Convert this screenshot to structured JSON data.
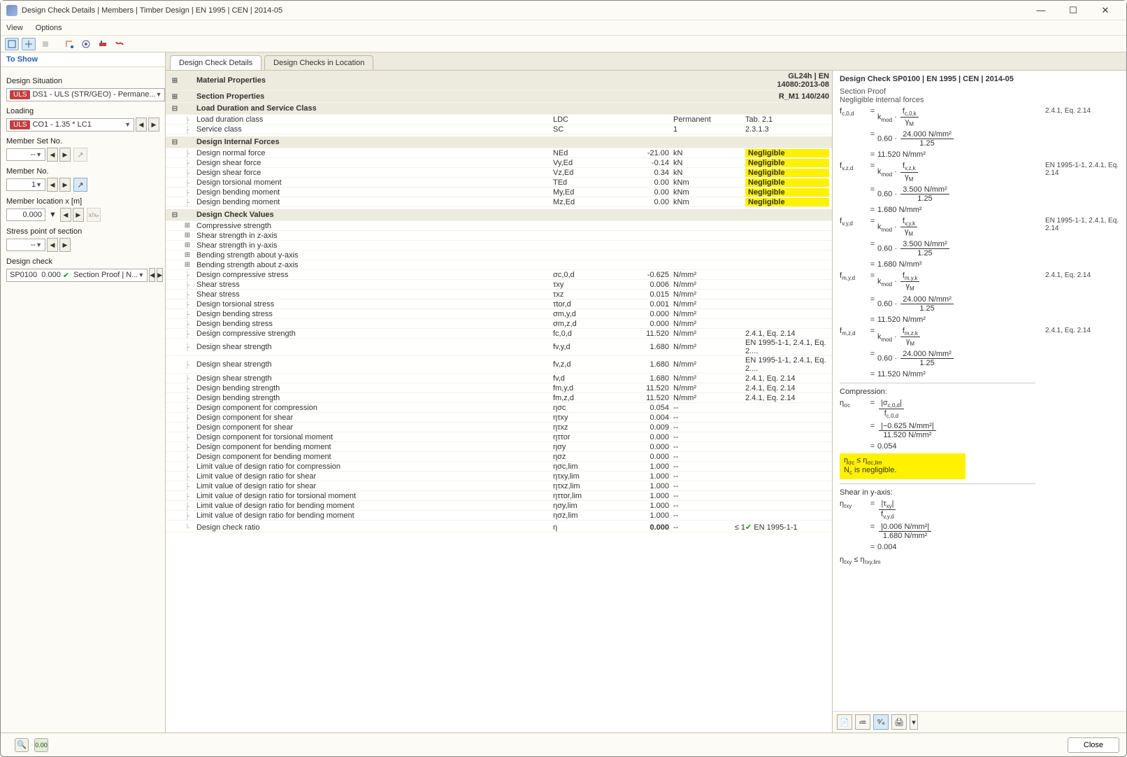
{
  "window": {
    "title": "Design Check Details | Members | Timber Design | EN 1995 | CEN | 2014-05"
  },
  "menu": {
    "view": "View",
    "options": "Options"
  },
  "sidebar": {
    "toshow": "To Show",
    "designSituation_lbl": "Design Situation",
    "designSituation_pill": "ULS",
    "designSituation_val": "DS1 - ULS (STR/GEO) - Permane...",
    "loading_lbl": "Loading",
    "loading_pill": "ULS",
    "loading_val": "CO1 - 1.35 * LC1",
    "memberSet_lbl": "Member Set No.",
    "memberSet_val": "--",
    "memberNo_lbl": "Member No.",
    "memberNo_val": "1",
    "memberLoc_lbl": "Member location x [m]",
    "memberLoc_val": "0.000",
    "stressPoint_lbl": "Stress point of section",
    "stressPoint_val": "--",
    "designCheck_lbl": "Design check",
    "designCheck_code": "SP0100",
    "designCheck_ratio": "0.000",
    "designCheck_text": "Section Proof | N..."
  },
  "tabs": {
    "t1": "Design Check Details",
    "t2": "Design Checks in Location"
  },
  "sections": {
    "matprop": "Material Properties",
    "matprop_ref": "GL24h | EN 14080:2013-08",
    "secprop": "Section Properties",
    "secprop_ref": "R_M1 140/240",
    "loadservice": "Load Duration and Service Class",
    "internalforces": "Design Internal Forces",
    "checkvalues": "Design Check Values",
    "compstr": "Compressive strength",
    "shearZ": "Shear strength in z-axis",
    "shearY": "Shear strength in y-axis",
    "bendY": "Bending strength about y-axis",
    "bendZ": "Bending strength about z-axis"
  },
  "rows_loadservice": [
    {
      "label": "Load duration class",
      "sym": "LDC",
      "val": "",
      "un": "Permanent",
      "ref": "Tab. 2.1"
    },
    {
      "label": "Service class",
      "sym": "SC",
      "val": "",
      "un": "1",
      "ref": "2.3.1.3"
    }
  ],
  "rows_internal": [
    {
      "label": "Design normal force",
      "sym": "NEd",
      "val": "-21.00",
      "un": "kN",
      "ref": "Negligible"
    },
    {
      "label": "Design shear force",
      "sym": "Vy,Ed",
      "val": "-0.14",
      "un": "kN",
      "ref": "Negligible"
    },
    {
      "label": "Design shear force",
      "sym": "Vz,Ed",
      "val": "0.34",
      "un": "kN",
      "ref": "Negligible"
    },
    {
      "label": "Design torsional moment",
      "sym": "TEd",
      "val": "0.00",
      "un": "kNm",
      "ref": "Negligible"
    },
    {
      "label": "Design bending moment",
      "sym": "My,Ed",
      "val": "0.00",
      "un": "kNm",
      "ref": "Negligible"
    },
    {
      "label": "Design bending moment",
      "sym": "Mz,Ed",
      "val": "0.00",
      "un": "kNm",
      "ref": "Negligible"
    }
  ],
  "rows_values": [
    {
      "label": "Design compressive stress",
      "sym": "σc,0,d",
      "val": "-0.625",
      "un": "N/mm²",
      "ref": ""
    },
    {
      "label": "Shear stress",
      "sym": "τxy",
      "val": "0.006",
      "un": "N/mm²",
      "ref": ""
    },
    {
      "label": "Shear stress",
      "sym": "τxz",
      "val": "0.015",
      "un": "N/mm²",
      "ref": ""
    },
    {
      "label": "Design torsional stress",
      "sym": "τtor,d",
      "val": "0.001",
      "un": "N/mm²",
      "ref": ""
    },
    {
      "label": "Design bending stress",
      "sym": "σm,y,d",
      "val": "0.000",
      "un": "N/mm²",
      "ref": ""
    },
    {
      "label": "Design bending stress",
      "sym": "σm,z,d",
      "val": "0.000",
      "un": "N/mm²",
      "ref": ""
    },
    {
      "label": "Design compressive strength",
      "sym": "fc,0,d",
      "val": "11.520",
      "un": "N/mm²",
      "ref": "2.4.1, Eq. 2.14"
    },
    {
      "label": "Design shear strength",
      "sym": "fv,y,d",
      "val": "1.680",
      "un": "N/mm²",
      "ref": "EN 1995-1-1, 2.4.1, Eq. 2...."
    },
    {
      "label": "Design shear strength",
      "sym": "fv,z,d",
      "val": "1.680",
      "un": "N/mm²",
      "ref": "EN 1995-1-1, 2.4.1, Eq. 2...."
    },
    {
      "label": "Design shear strength",
      "sym": "fv,d",
      "val": "1.680",
      "un": "N/mm²",
      "ref": "2.4.1, Eq. 2.14"
    },
    {
      "label": "Design bending strength",
      "sym": "fm,y,d",
      "val": "11.520",
      "un": "N/mm²",
      "ref": "2.4.1, Eq. 2.14"
    },
    {
      "label": "Design bending strength",
      "sym": "fm,z,d",
      "val": "11.520",
      "un": "N/mm²",
      "ref": "2.4.1, Eq. 2.14"
    },
    {
      "label": "Design component for compression",
      "sym": "ησc",
      "val": "0.054",
      "un": "--",
      "ref": ""
    },
    {
      "label": "Design component for shear",
      "sym": "ητxy",
      "val": "0.004",
      "un": "--",
      "ref": ""
    },
    {
      "label": "Design component for shear",
      "sym": "ητxz",
      "val": "0.009",
      "un": "--",
      "ref": ""
    },
    {
      "label": "Design component for torsional moment",
      "sym": "ηττor",
      "val": "0.000",
      "un": "--",
      "ref": ""
    },
    {
      "label": "Design component for bending moment",
      "sym": "ησy",
      "val": "0.000",
      "un": "--",
      "ref": ""
    },
    {
      "label": "Design component for bending moment",
      "sym": "ησz",
      "val": "0.000",
      "un": "--",
      "ref": ""
    },
    {
      "label": "Limit value of design ratio for compression",
      "sym": "ησc,lim",
      "val": "1.000",
      "un": "--",
      "ref": ""
    },
    {
      "label": "Limit value of design ratio for shear",
      "sym": "ητxy,lim",
      "val": "1.000",
      "un": "--",
      "ref": ""
    },
    {
      "label": "Limit value of design ratio for shear",
      "sym": "ητxz,lim",
      "val": "1.000",
      "un": "--",
      "ref": ""
    },
    {
      "label": "Limit value of design ratio for torsional moment",
      "sym": "ηττor,lim",
      "val": "1.000",
      "un": "--",
      "ref": ""
    },
    {
      "label": "Limit value of design ratio for bending moment",
      "sym": "ησy,lim",
      "val": "1.000",
      "un": "--",
      "ref": ""
    },
    {
      "label": "Limit value of design ratio for bending moment",
      "sym": "ησz,lim",
      "val": "1.000",
      "un": "--",
      "ref": ""
    }
  ],
  "finalrow": {
    "label": "Design check ratio",
    "sym": "η",
    "val": "0.000",
    "un": "--",
    "lim": "≤ 1",
    "ref": "EN 1995-1-1"
  },
  "right": {
    "title": "Design Check SP0100 | EN 1995 | CEN | 2014-05",
    "sub1": "Section Proof",
    "sub2": "Negligible internal forces",
    "ref_2414": "2.4.1, Eq. 2.14",
    "ref_en": "EN 1995-1-1, 2.4.1, Eq. 2.14",
    "eqs": [
      {
        "lhs": "f<sub class='ssub'>c,0,d</sub>",
        "kmod": "k<sub class='ssub'>mod</sub>",
        "fnum": "f<sub class='ssub'>c,0,k</sub>",
        "fden": "γ<sub class='ssub'>M</sub>",
        "vnum": "24.000 N/mm²",
        "vden": "1.25",
        "res": "11.520 N/mm²",
        "ref": "2.4.1, Eq. 2.14"
      },
      {
        "lhs": "f<sub class='ssub'>v,z,d</sub>",
        "kmod": "k<sub class='ssub'>mod</sub>",
        "fnum": "f<sub class='ssub'>v,z,k</sub>",
        "fden": "γ<sub class='ssub'>M</sub>",
        "vnum": "3.500 N/mm²",
        "vden": "1.25",
        "res": "1.680 N/mm²",
        "ref": "EN 1995-1-1, 2.4.1, Eq. 2.14"
      },
      {
        "lhs": "f<sub class='ssub'>v,y,d</sub>",
        "kmod": "k<sub class='ssub'>mod</sub>",
        "fnum": "f<sub class='ssub'>v,y,k</sub>",
        "fden": "γ<sub class='ssub'>M</sub>",
        "vnum": "3.500 N/mm²",
        "vden": "1.25",
        "res": "1.680 N/mm²",
        "ref": "EN 1995-1-1, 2.4.1, Eq. 2.14"
      },
      {
        "lhs": "f<sub class='ssub'>m,y,d</sub>",
        "kmod": "k<sub class='ssub'>mod</sub>",
        "fnum": "f<sub class='ssub'>m,y,k</sub>",
        "fden": "γ<sub class='ssub'>M</sub>",
        "vnum": "24.000 N/mm²",
        "vden": "1.25",
        "res": "11.520 N/mm²",
        "ref": "2.4.1, Eq. 2.14"
      },
      {
        "lhs": "f<sub class='ssub'>m,z,d</sub>",
        "kmod": "k<sub class='ssub'>mod</sub>",
        "fnum": "f<sub class='ssub'>m,z,k</sub>",
        "fden": "γ<sub class='ssub'>M</sub>",
        "vnum": "24.000 N/mm²",
        "vden": "1.25",
        "res": "11.520 N/mm²",
        "ref": "2.4.1, Eq. 2.14"
      }
    ],
    "compression_lbl": "Compression:",
    "compression_eta_num": "|σ<sub class='ssub'>c,0,d</sub>|",
    "compression_eta_den": "f<sub class='ssub'>c,0,d</sub>",
    "compression_vnum": "|−0.625 N/mm²|",
    "compression_vden": "11.520 N/mm²",
    "compression_res": "0.054",
    "compression_check": "η<sub class='ssub'>σc</sub>  ≤  η<sub class='ssub'>σc,lim</sub>",
    "compression_neg": "N<sub class='ssub'>c</sub> is negligible.",
    "shearY_lbl": "Shear in y-axis:",
    "shearY_num": "|τ<sub class='ssub'>xy</sub>|",
    "shearY_den": "f<sub class='ssub'>v,y,d</sub>",
    "shearY_vnum": "|0.006 N/mm²|",
    "shearY_vden": "1.680 N/mm²",
    "shearY_res": "0.004",
    "shearY_check": "η<sub class='ssub'>τxy</sub>  ≤  η<sub class='ssub'>τxy,lim</sub>"
  },
  "footer": {
    "close": "Close"
  }
}
